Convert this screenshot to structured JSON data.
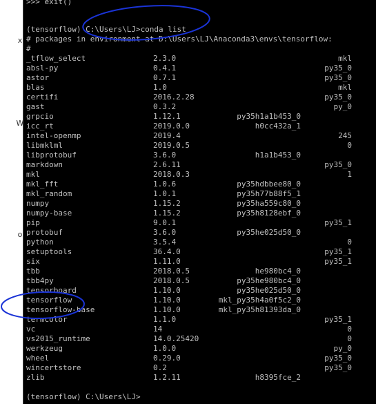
{
  "left_edge_fragments": [
    "ⅹ",
    "W",
    "o"
  ],
  "console": {
    "top_partial": ">>> exit()",
    "command_line": "(tensorflow) C:\\Users\\LJ>conda list",
    "header_line_1": "# packages in environment at D:\\Users\\LJ\\Anaconda3\\envs\\tensorflow:",
    "header_line_2": "#",
    "packages": [
      {
        "name": "_tflow_select",
        "version": "2.3.0",
        "build": "",
        "channel": "mkl"
      },
      {
        "name": "absl-py",
        "version": "0.4.1",
        "build": "",
        "channel": "py35_0"
      },
      {
        "name": "astor",
        "version": "0.7.1",
        "build": "",
        "channel": "py35_0"
      },
      {
        "name": "blas",
        "version": "1.0",
        "build": "",
        "channel": "mkl"
      },
      {
        "name": "certifi",
        "version": "2016.2.28",
        "build": "",
        "channel": "py35_0"
      },
      {
        "name": "gast",
        "version": "0.3.2",
        "build": "",
        "channel": "py_0"
      },
      {
        "name": "grpcio",
        "version": "1.12.1",
        "build": "py35h1a1b453_0",
        "channel": ""
      },
      {
        "name": "icc_rt",
        "version": "2019.0.0",
        "build": "h0cc432a_1",
        "channel": ""
      },
      {
        "name": "intel-openmp",
        "version": "2019.4",
        "build": "",
        "channel": "245"
      },
      {
        "name": "libmklml",
        "version": "2019.0.5",
        "build": "",
        "channel": "0"
      },
      {
        "name": "libprotobuf",
        "version": "3.6.0",
        "build": "h1a1b453_0",
        "channel": ""
      },
      {
        "name": "markdown",
        "version": "2.6.11",
        "build": "",
        "channel": "py35_0"
      },
      {
        "name": "mkl",
        "version": "2018.0.3",
        "build": "",
        "channel": "1"
      },
      {
        "name": "mkl_fft",
        "version": "1.0.6",
        "build": "py35hdbbee80_0",
        "channel": ""
      },
      {
        "name": "mkl_random",
        "version": "1.0.1",
        "build": "py35h77b88f5_1",
        "channel": ""
      },
      {
        "name": "numpy",
        "version": "1.15.2",
        "build": "py35ha559c80_0",
        "channel": ""
      },
      {
        "name": "numpy-base",
        "version": "1.15.2",
        "build": "py35h8128ebf_0",
        "channel": ""
      },
      {
        "name": "pip",
        "version": "9.0.1",
        "build": "",
        "channel": "py35_1"
      },
      {
        "name": "protobuf",
        "version": "3.6.0",
        "build": "py35he025d50_0",
        "channel": ""
      },
      {
        "name": "python",
        "version": "3.5.4",
        "build": "",
        "channel": "0"
      },
      {
        "name": "setuptools",
        "version": "36.4.0",
        "build": "",
        "channel": "py35_1"
      },
      {
        "name": "six",
        "version": "1.11.0",
        "build": "",
        "channel": "py35_1"
      },
      {
        "name": "tbb",
        "version": "2018.0.5",
        "build": "he980bc4_0",
        "channel": ""
      },
      {
        "name": "tbb4py",
        "version": "2018.0.5",
        "build": "py35he980bc4_0",
        "channel": ""
      },
      {
        "name": "tensorboard",
        "version": "1.10.0",
        "build": "py35he025d50_0",
        "channel": ""
      },
      {
        "name": "tensorflow",
        "version": "1.10.0",
        "build": "mkl_py35h4a0f5c2_0",
        "channel": ""
      },
      {
        "name": "tensorflow-base",
        "version": "1.10.0",
        "build": "mkl_py35h81393da_0",
        "channel": ""
      },
      {
        "name": "termcolor",
        "version": "1.1.0",
        "build": "",
        "channel": "py35_1"
      },
      {
        "name": "vc",
        "version": "14",
        "build": "",
        "channel": "0"
      },
      {
        "name": "vs2015_runtime",
        "version": "14.0.25420",
        "build": "",
        "channel": "0"
      },
      {
        "name": "werkzeug",
        "version": "1.0.0",
        "build": "",
        "channel": "py_0"
      },
      {
        "name": "wheel",
        "version": "0.29.0",
        "build": "",
        "channel": "py35_0"
      },
      {
        "name": "wincertstore",
        "version": "0.2",
        "build": "",
        "channel": "py35_0"
      },
      {
        "name": "zlib",
        "version": "1.2.11",
        "build": "h8395fce_2",
        "channel": ""
      }
    ],
    "final_prompt": "(tensorflow) C:\\Users\\LJ>"
  },
  "colors": {
    "console_bg": "#000000",
    "console_text": "#c0c0c0",
    "annotation": "#1a33d6"
  }
}
